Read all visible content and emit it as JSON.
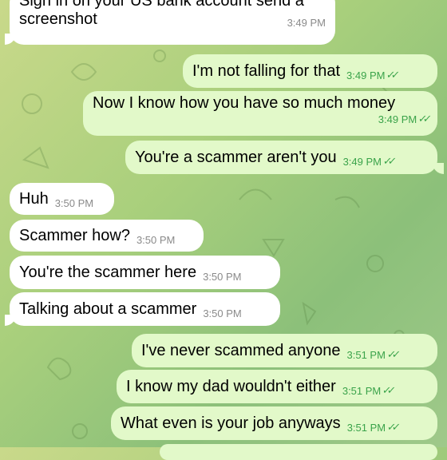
{
  "colors": {
    "incoming_bubble": "#ffffff",
    "outgoing_bubble": "#e2f9c9",
    "read_check": "#3aa34a"
  },
  "messages": [
    {
      "side": "in",
      "text_line1": "Sign in on your US bank account send a",
      "text_line2": "screenshot",
      "time": "3:49 PM"
    },
    {
      "side": "out",
      "text": "I'm not falling for that",
      "time": "3:49 PM",
      "status_icon": "double-check-icon"
    },
    {
      "side": "out",
      "text": "Now I know how you have so much money",
      "time": "3:49 PM",
      "status_icon": "double-check-icon"
    },
    {
      "side": "out",
      "text": "You're a scammer aren't you",
      "time": "3:49 PM",
      "status_icon": "double-check-icon"
    },
    {
      "side": "in",
      "text": "Huh",
      "time": "3:50 PM"
    },
    {
      "side": "in",
      "text": "Scammer how?",
      "time": "3:50 PM"
    },
    {
      "side": "in",
      "text": "You're the scammer here",
      "time": "3:50 PM"
    },
    {
      "side": "in",
      "text": "Talking about a scammer",
      "time": "3:50 PM"
    },
    {
      "side": "out",
      "text": "I've never scammed anyone",
      "time": "3:51 PM",
      "status_icon": "double-check-icon"
    },
    {
      "side": "out",
      "text": "I know my dad wouldn't either",
      "time": "3:51 PM",
      "status_icon": "double-check-icon"
    },
    {
      "side": "out",
      "text": "What even is your job anyways",
      "time": "3:51 PM",
      "status_icon": "double-check-icon"
    }
  ]
}
